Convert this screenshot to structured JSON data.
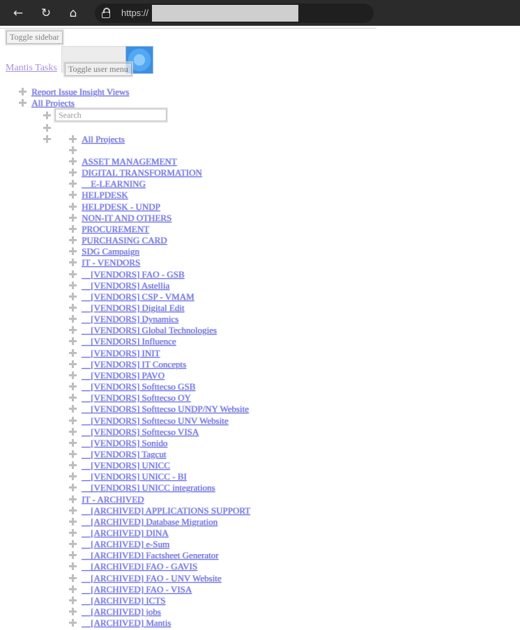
{
  "browser": {
    "url_prefix": "https://",
    "back_icon": "arrow-left-icon",
    "reload_icon": "reload-icon",
    "home_icon": "home-icon",
    "lock_icon": "lock-icon"
  },
  "header": {
    "toggle_sidebar": "Toggle sidebar",
    "app_title": "Mantis Tasks",
    "toggle_user_menu": "Toggle user menu"
  },
  "tree": {
    "report": "Report Issue Insight Views",
    "all_projects_root": "All Projects",
    "search_placeholder": "Search",
    "all_projects": "All Projects",
    "projects": [
      "ASSET MANAGEMENT",
      "DIGITAL TRANSFORMATION",
      "__E-LEARNING",
      "HELPDESK",
      "HELPDESK - UNDP",
      "NON-IT AND OTHERS",
      "PROCUREMENT",
      "PURCHASING CARD",
      "SDG Campaign",
      "IT - VENDORS",
      "__[VENDORS] FAO - GSB",
      "__[VENDORS] Astellia",
      "__[VENDORS] CSP - VMAM",
      "__[VENDORS] Digital Edit",
      "__[VENDORS] Dynamics",
      "__[VENDORS] Global Technologies",
      "__[VENDORS] Influence",
      "__[VENDORS] INIT",
      "__[VENDORS] IT Concepts",
      "__[VENDORS] PAVO",
      "__[VENDORS] Softtecso GSB",
      "__[VENDORS] Softtecso OY",
      "__[VENDORS] Softtecso UNDP/NY Website",
      "__[VENDORS] Softtecso UNV Website",
      "__[VENDORS] Softtecso VISA",
      "__[VENDORS] Sonido",
      "__[VENDORS] Tagcut",
      "__[VENDORS] UNICC",
      "__[VENDORS] UNICC - BI",
      "__[VENDORS] UNICC integrations",
      "IT - ARCHIVED",
      "__[ARCHIVED] APPLICATIONS SUPPORT",
      "__[ARCHIVED] Database Migration",
      "__[ARCHIVED] DINA",
      "__[ARCHIVED] e-Sum",
      "__[ARCHIVED] Factsheet Generator",
      "__[ARCHIVED] FAO - GAVIS",
      "__[ARCHIVED] FAO - UNV Website",
      "__[ARCHIVED] FAO - VISA",
      "__[ARCHIVED] ICTS",
      "__[ARCHIVED] jobs",
      "__[ARCHIVED] Mantis"
    ]
  }
}
